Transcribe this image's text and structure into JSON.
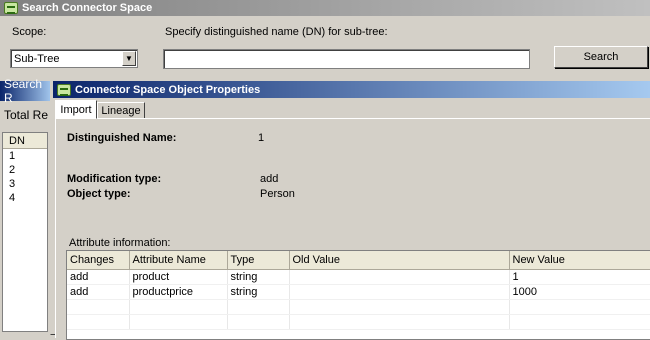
{
  "search_window": {
    "title": "Search Connector Space",
    "scope_label": "Scope:",
    "scope_value": "Sub-Tree",
    "dn_label": "Specify distinguished name (DN) for sub-tree:",
    "dn_value": "",
    "search_button": "Search",
    "results_header": "Search R",
    "total_label": "Total Re",
    "dn_column": "DN",
    "dn_rows": [
      "1",
      "2",
      "3",
      "4"
    ]
  },
  "properties_dialog": {
    "title": "Connector Space Object Properties",
    "tabs": [
      {
        "label": "Import",
        "selected": true
      },
      {
        "label": "Lineage",
        "selected": false
      }
    ],
    "distinguished_name_label": "Distinguished Name:",
    "distinguished_name_value": "1",
    "modification_type_label": "Modification type:",
    "modification_type_value": "add",
    "object_type_label": "Object type:",
    "object_type_value": "Person",
    "attribute_info_label": "Attribute information:",
    "columns": [
      "Changes",
      "Attribute Name",
      "Type",
      "Old Value",
      "New Value"
    ],
    "rows": [
      [
        "add",
        "product",
        "string",
        "",
        "1"
      ],
      [
        "add",
        "productprice",
        "string",
        "",
        "1000"
      ]
    ]
  },
  "colors": {
    "active_title_start": "#0a246a",
    "active_title_end": "#a6caf0",
    "inactive_title_start": "#808080",
    "window_face": "#d4d0c8"
  },
  "icons": {
    "app_icon": "connector-icon",
    "dropdown_arrow": "chevron-down-icon"
  }
}
